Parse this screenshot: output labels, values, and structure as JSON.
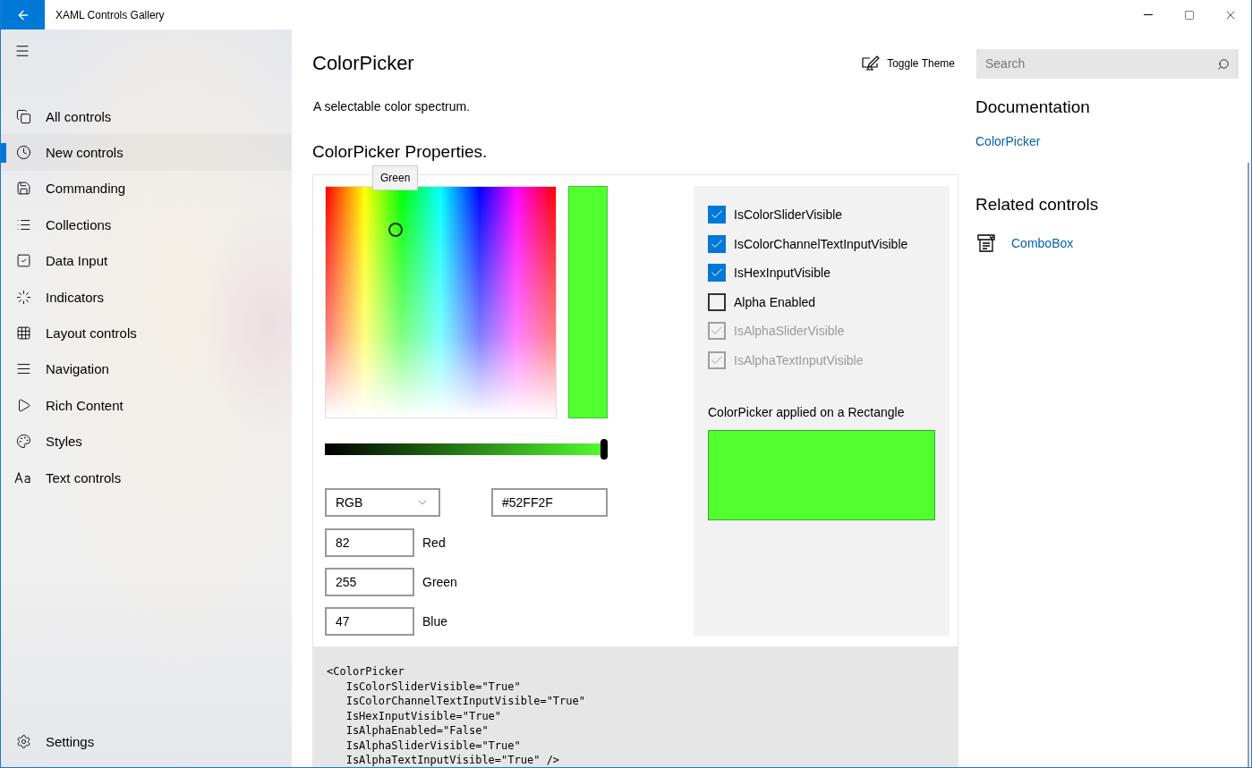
{
  "window": {
    "title": "XAML Controls Gallery"
  },
  "sidebar": {
    "items": [
      {
        "label": "All controls",
        "selected": false
      },
      {
        "label": "New controls",
        "selected": true
      },
      {
        "label": "Commanding",
        "selected": false
      },
      {
        "label": "Collections",
        "selected": false
      },
      {
        "label": "Data Input",
        "selected": false
      },
      {
        "label": "Indicators",
        "selected": false
      },
      {
        "label": "Layout controls",
        "selected": false
      },
      {
        "label": "Navigation",
        "selected": false
      },
      {
        "label": "Rich Content",
        "selected": false
      },
      {
        "label": "Styles",
        "selected": false
      },
      {
        "label": "Text controls",
        "selected": false
      }
    ],
    "footer": "Settings"
  },
  "header": {
    "title": "ColorPicker",
    "toggle": "Toggle Theme",
    "search": {
      "placeholder": "Search"
    }
  },
  "description": "A selectable color spectrum.",
  "example": {
    "heading": "ColorPicker Properties.",
    "tooltip": "Green",
    "color": "#52ff2f",
    "slider": {
      "level": 1
    },
    "mode": "RGB",
    "hex": "#52FF2F",
    "channels": [
      {
        "value": "82",
        "label": "Red"
      },
      {
        "value": "255",
        "label": "Green"
      },
      {
        "value": "47",
        "label": "Blue"
      }
    ],
    "options": [
      {
        "label": "IsColorSliderVisible",
        "checked": true,
        "disabled": false
      },
      {
        "label": "IsColorChannelTextInputVisible",
        "checked": true,
        "disabled": false
      },
      {
        "label": "IsHexInputVisible",
        "checked": true,
        "disabled": false
      },
      {
        "label": "Alpha Enabled",
        "checked": false,
        "disabled": false
      },
      {
        "label": "IsAlphaSliderVisible",
        "checked": true,
        "disabled": true
      },
      {
        "label": "IsAlphaTextInputVisible",
        "checked": true,
        "disabled": true
      }
    ],
    "rectangle_label": "ColorPicker applied on a Rectangle",
    "code": "<ColorPicker\n   IsColorSliderVisible=\"True\"\n   IsColorChannelTextInputVisible=\"True\"\n   IsHexInputVisible=\"True\"\n   IsAlphaEnabled=\"False\"\n   IsAlphaSliderVisible=\"True\"\n   IsAlphaTextInputVisible=\"True\" />"
  },
  "documentation": {
    "heading": "Documentation",
    "links": [
      "ColorPicker"
    ]
  },
  "related": {
    "heading": "Related controls",
    "items": [
      "ComboBox"
    ]
  }
}
